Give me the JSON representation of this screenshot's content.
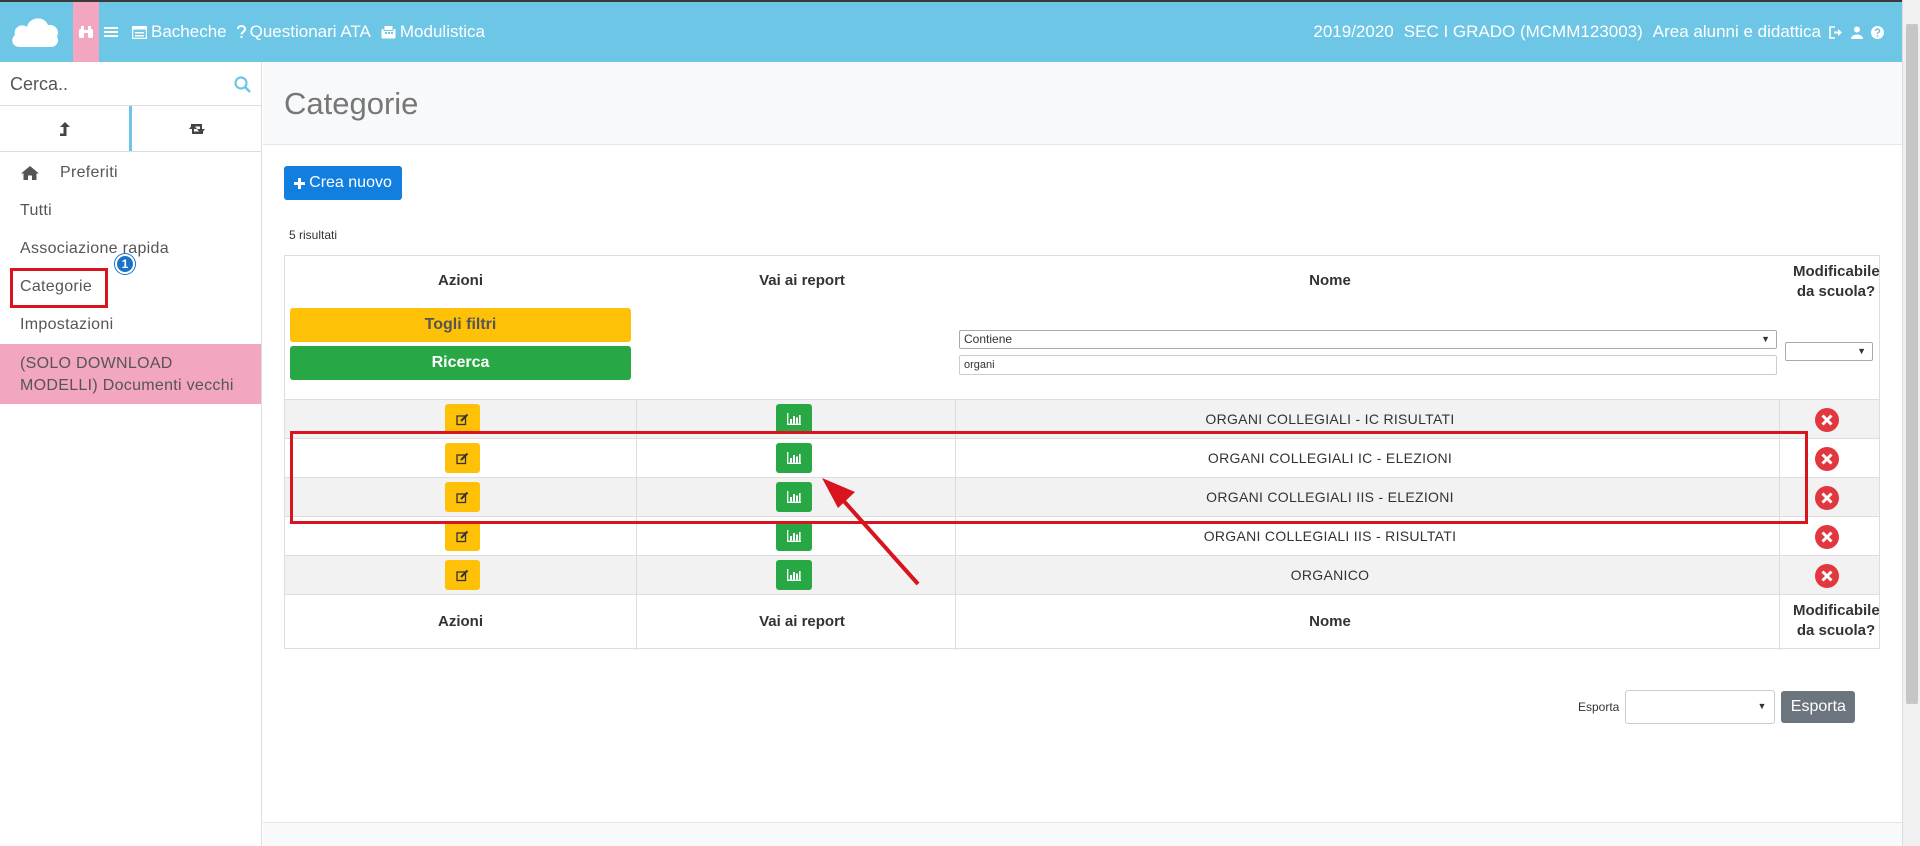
{
  "topbar": {
    "nav": [
      {
        "label": "Bacheche",
        "icon": "board-icon"
      },
      {
        "label": "Questionari ATA",
        "icon": "question-icon"
      },
      {
        "label": "Modulistica",
        "icon": "fax-icon"
      }
    ],
    "year": "2019/2020",
    "school": "SEC I GRADO (MCMM123003)",
    "area": "Area alunni e didattica",
    "accent": "#6ec6e6"
  },
  "sidebar": {
    "search_placeholder": "Cerca..",
    "items": [
      {
        "label": "Preferiti"
      },
      {
        "label": "Tutti"
      },
      {
        "label": "Associazione rapida"
      },
      {
        "label": "Categorie"
      },
      {
        "label": "Impostazioni"
      },
      {
        "label": "(SOLO DOWNLOAD MODELLI) Documenti vecchi"
      }
    ],
    "badge": "1"
  },
  "main": {
    "title": "Categorie",
    "create_label": "Crea nuovo",
    "results": "5 risultati",
    "headers": {
      "azioni": "Azioni",
      "report": "Vai ai report",
      "nome": "Nome",
      "modificabile": "Modificabile da scuola?"
    },
    "filter_buttons": {
      "reset": "Togli filtri",
      "search": "Ricerca"
    },
    "filter": {
      "mode": "Contiene",
      "value": "organi"
    },
    "rows": [
      {
        "name": "ORGANI COLLEGIALI - IC RISULTATI"
      },
      {
        "name": "ORGANI COLLEGIALI IC - ELEZIONI"
      },
      {
        "name": "ORGANI COLLEGIALI IIS - ELEZIONI"
      },
      {
        "name": "ORGANI COLLEGIALI IIS - RISULTATI"
      },
      {
        "name": "ORGANICO"
      }
    ],
    "export": {
      "label": "Esporta",
      "button": "Esporta"
    }
  }
}
